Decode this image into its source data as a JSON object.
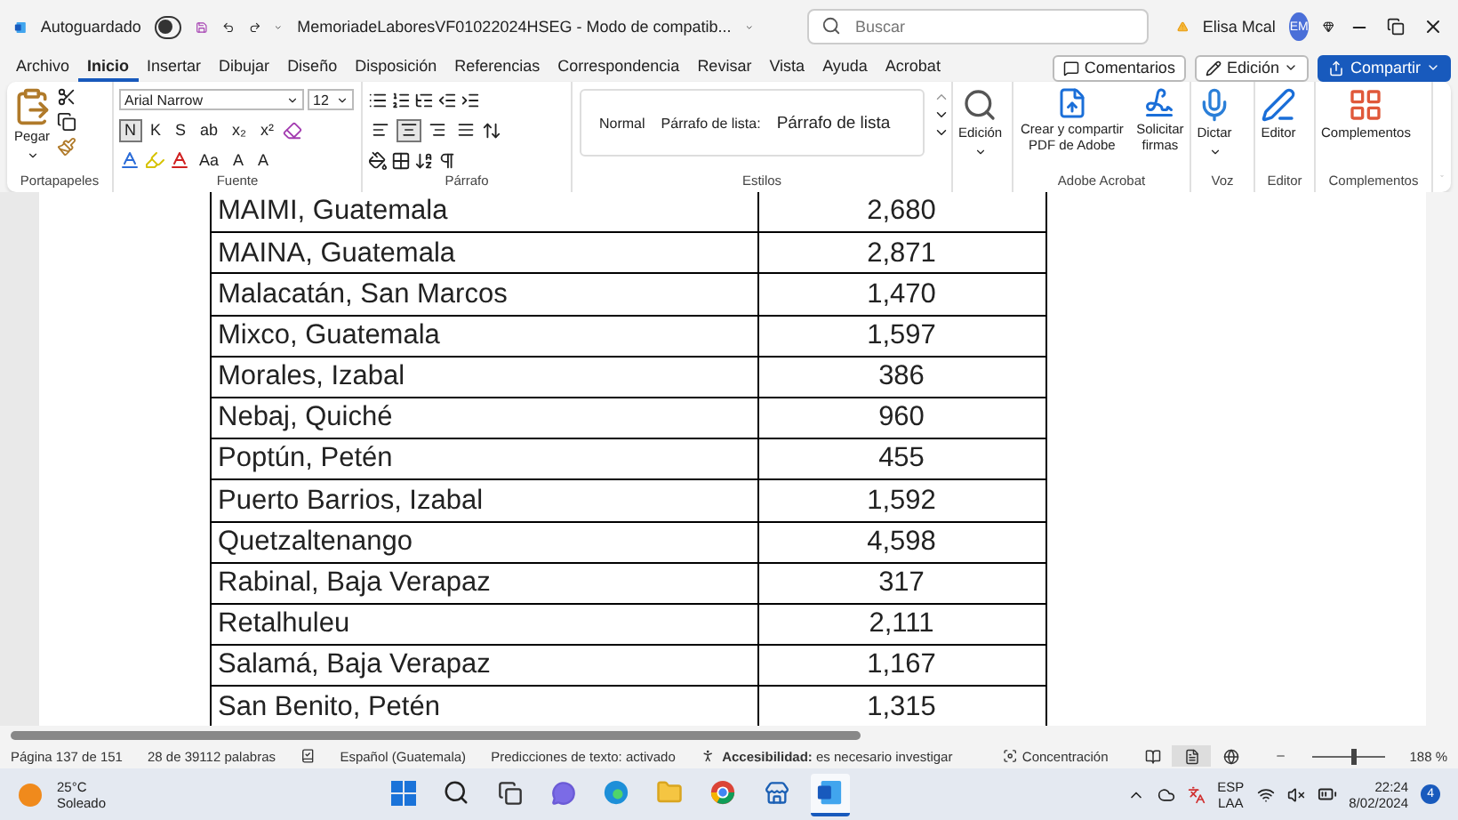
{
  "title_bar": {
    "autosave_label": "Autoguardado",
    "autosave_on": false,
    "document_title": "MemoriadeLaboresVF01022024HSEG  -  Modo de compatib...",
    "search": {
      "placeholder": "Buscar"
    },
    "user_name": "Elisa Mcal",
    "avatar_initials": "EM"
  },
  "menu_tabs": [
    {
      "label": "Archivo",
      "selected": false
    },
    {
      "label": "Inicio",
      "selected": true
    },
    {
      "label": "Insertar",
      "selected": false
    },
    {
      "label": "Dibujar",
      "selected": false
    },
    {
      "label": "Diseño",
      "selected": false
    },
    {
      "label": "Disposición",
      "selected": false
    },
    {
      "label": "Referencias",
      "selected": false
    },
    {
      "label": "Correspondencia",
      "selected": false
    },
    {
      "label": "Revisar",
      "selected": false
    },
    {
      "label": "Vista",
      "selected": false
    },
    {
      "label": "Ayuda",
      "selected": false
    },
    {
      "label": "Acrobat",
      "selected": false
    }
  ],
  "menu_buttons": {
    "comments": "Comentarios",
    "editing": "Edición",
    "share": "Compartir"
  },
  "ribbon": {
    "clipboard": {
      "paste": "Pegar",
      "label": "Portapapeles"
    },
    "font": {
      "font_name": "Arial Narrow",
      "font_size": "12",
      "format_buttons": [
        {
          "text": "N",
          "selected": true
        },
        {
          "text": "K",
          "selected": false
        },
        {
          "text": "S",
          "selected": false
        },
        {
          "text": "ab",
          "selected": false
        },
        {
          "text": "x₂",
          "selected": false
        },
        {
          "text": "x²",
          "selected": false
        }
      ],
      "row3_buttons": [
        "Aa",
        "A",
        "A"
      ],
      "label": "Fuente"
    },
    "paragraph": {
      "alignment": [
        {
          "kind": "left",
          "selected": false
        },
        {
          "kind": "center",
          "selected": true
        },
        {
          "kind": "right",
          "selected": false
        },
        {
          "kind": "justify",
          "selected": false
        }
      ],
      "label": "Párrafo"
    },
    "styles": {
      "items": [
        "Normal",
        "Párrafo de lista:",
        "Párrafo de lista"
      ],
      "label": "Estilos"
    },
    "editing": {
      "label": "Edición"
    },
    "acrobat": {
      "buttons": [
        "Crear y compartir PDF de Adobe",
        "Solicitar firmas"
      ],
      "label": "Adobe Acrobat"
    },
    "voice": {
      "button": "Dictar",
      "label": "Voz"
    },
    "editor": {
      "button": "Editor",
      "label": "Editor"
    },
    "addins": {
      "button": "Complementos",
      "label": "Complementos"
    }
  },
  "table": {
    "rows": [
      [
        "MAIMI, Guatemala",
        "2,680"
      ],
      [
        "MAINA, Guatemala",
        "2,871"
      ],
      [
        "Malacatán, San Marcos",
        "1,470"
      ],
      [
        "Mixco, Guatemala",
        "1,597"
      ],
      [
        "Morales, Izabal",
        "386"
      ],
      [
        "Nebaj, Quiché",
        "960"
      ],
      [
        "Poptún, Petén",
        "455"
      ],
      [
        "Puerto Barrios, Izabal",
        "1,592"
      ],
      [
        "Quetzaltenango",
        "4,598"
      ],
      [
        "Rabinal, Baja Verapaz",
        "317"
      ],
      [
        "Retalhuleu",
        "2,111"
      ],
      [
        "Salamá, Baja Verapaz",
        "1,167"
      ],
      [
        "San Benito, Petén",
        "1,315"
      ]
    ]
  },
  "status_bar": {
    "page": "Página 137 de 151",
    "words": "28 de 39112 palabras",
    "language": "Español (Guatemala)",
    "predictions": "Predicciones de texto: activado",
    "accessibility": "**Accesibilidad:** es necesario investigar",
    "focus": "Concentración",
    "views": [
      {
        "kind": "read",
        "selected": false
      },
      {
        "kind": "print",
        "selected": true
      },
      {
        "kind": "web",
        "selected": false
      }
    ],
    "zoom": {
      "level": 0.55,
      "reading": "188 %"
    }
  },
  "taskbar": {
    "weather": {
      "temperature": "25°C",
      "condition": "Soleado"
    },
    "apps": [
      {
        "kind": "start",
        "active": false
      },
      {
        "kind": "search",
        "active": false
      },
      {
        "kind": "taskview",
        "active": false
      },
      {
        "kind": "chat",
        "active": false
      },
      {
        "kind": "edge",
        "active": false
      },
      {
        "kind": "files",
        "active": false
      },
      {
        "kind": "chrome",
        "active": false
      },
      {
        "kind": "store",
        "active": false
      },
      {
        "kind": "word",
        "active": true
      }
    ],
    "language": [
      "ESP",
      "LAA"
    ],
    "time": "22:24",
    "date": "8/02/2024",
    "notifications": "4"
  }
}
